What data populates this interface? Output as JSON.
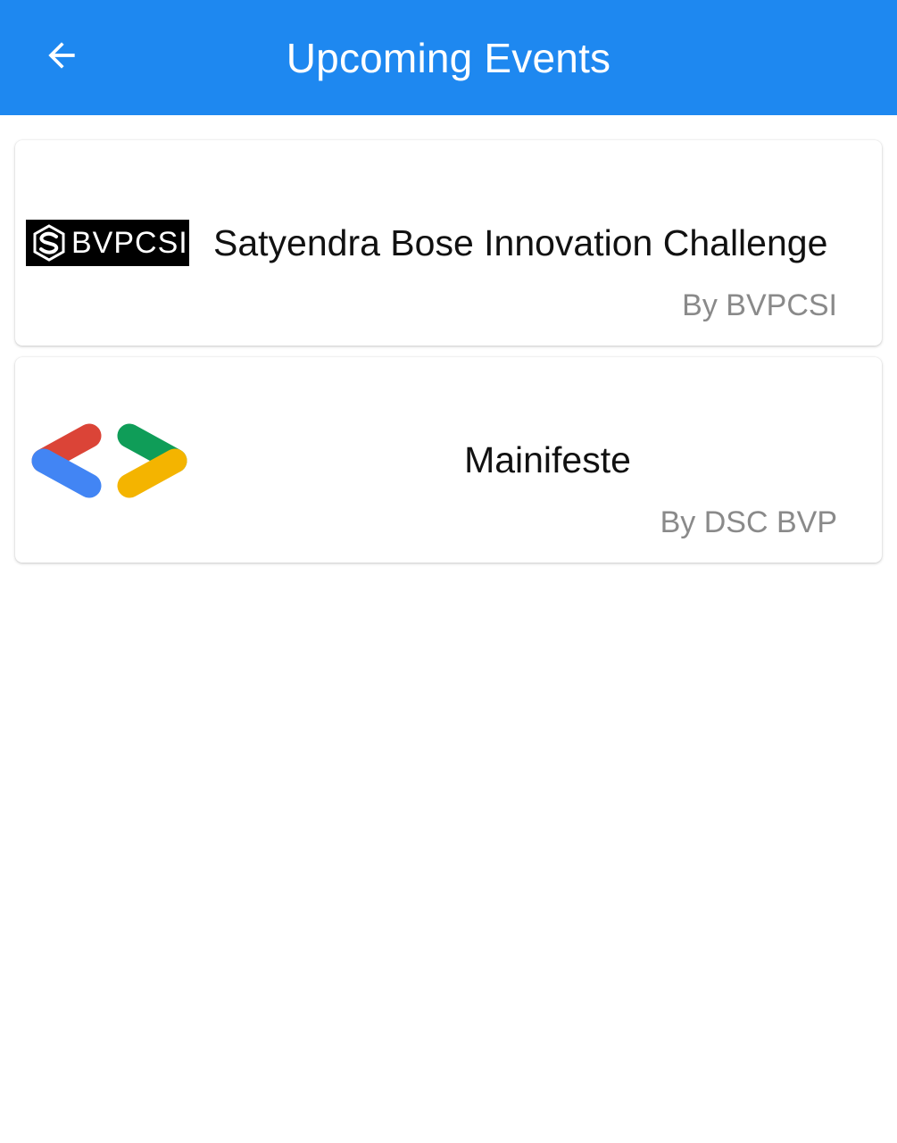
{
  "app_bar": {
    "title": "Upcoming Events",
    "back_icon": "arrow-left-icon",
    "background": "#1e88f0"
  },
  "events": [
    {
      "logo_text": "BVPCSI",
      "logo_icon": "bvpcsi-logo-icon",
      "title": "Satyendra Bose Innovation Challenge",
      "subtitle": "By BVPCSI"
    },
    {
      "logo_icon": "dsc-logo-icon",
      "title": "Mainifeste",
      "subtitle": "By DSC BVP"
    }
  ]
}
